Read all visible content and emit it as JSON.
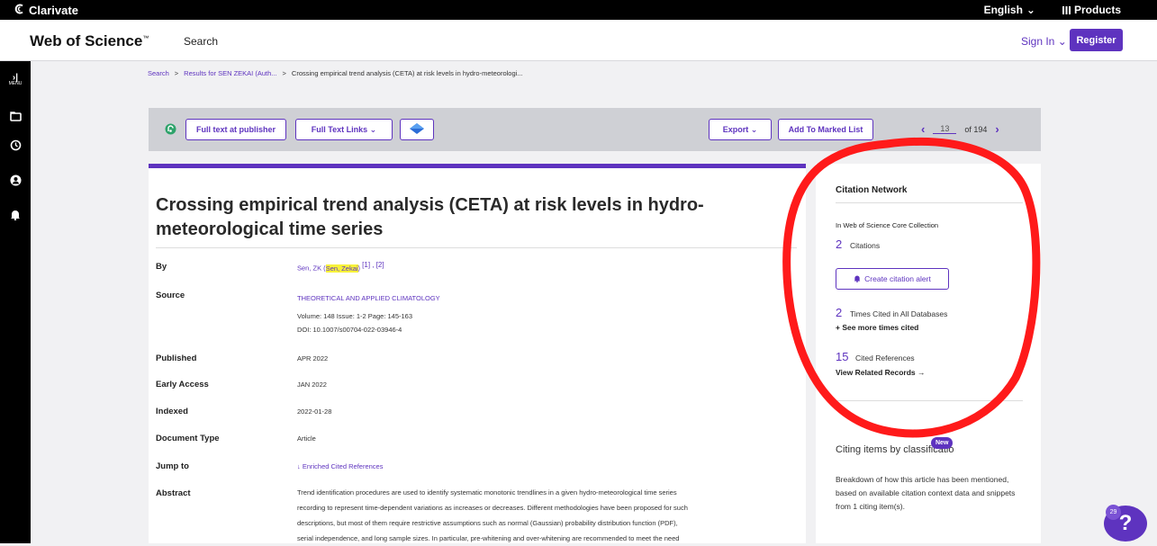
{
  "topbar": {
    "brand": "Clarivate",
    "language": "English",
    "products": "Products"
  },
  "header": {
    "app_title": "Web of Science",
    "trademark": "™",
    "search_link": "Search",
    "sign_in": "Sign In",
    "register": "Register"
  },
  "rail": {
    "menu_label": "MENU",
    "icons": [
      "expand-icon",
      "folder-icon",
      "history-icon",
      "account-icon",
      "bell-icon"
    ]
  },
  "breadcrumb": {
    "items": [
      "Search",
      "Results for SEN ZEKAI (Auth...",
      "Crossing empirical trend analysis (CETA) at risk levels in hydro-meteorologi..."
    ],
    "separator": ">"
  },
  "toolbar": {
    "full_text_publisher": "Full text at publisher",
    "full_text_links": "Full Text Links",
    "export": "Export",
    "add_marked": "Add To Marked List",
    "page_current": "13",
    "page_total": "of 194"
  },
  "record": {
    "title_line1": "Crossing empirical trend analysis (CETA) at risk levels in hydro-",
    "title_line2": "meteorological time series",
    "fields": {
      "by_label": "By",
      "by_value_prefix": "Sen, ZK (",
      "by_value_highlight": "Sen, Zekai",
      "by_value_suffix": ")",
      "by_refs": "[1] , [2]",
      "source_label": "Source",
      "source_journal": "THEORETICAL AND APPLIED CLIMATOLOGY",
      "source_volume": "Volume: 148    Issue: 1-2    Page: 145-163",
      "source_doi": "DOI: 10.1007/s00704-022-03946-4",
      "published_label": "Published",
      "published_value": "APR 2022",
      "early_access_label": "Early Access",
      "early_access_value": "JAN 2022",
      "indexed_label": "Indexed",
      "indexed_value": "2022-01-28",
      "doc_type_label": "Document Type",
      "doc_type_value": "Article",
      "jump_label": "Jump to",
      "jump_value": "↓ Enriched Cited References",
      "abstract_label": "Abstract"
    },
    "abstract_lines": [
      "Trend identification procedures are used to identify systematic monotonic trendlines in a given hydro-meteorological time series",
      "recording to represent time-dependent variations as increases or decreases. Different methodologies have been proposed for such",
      "descriptions, but most of them require restrictive assumptions such as normal (Gaussian) probability distribution function (PDF),",
      "serial independence, and long sample sizes. In particular, pre-whitening and over-whitening are recommended to meet the need"
    ]
  },
  "citation_network": {
    "title": "Citation Network",
    "subtitle": "In Web of Science Core Collection",
    "citations_count": "2",
    "citations_label": "Citations",
    "alert_button": "Create citation alert",
    "times_cited_count": "2",
    "times_cited_label": "Times Cited in All Databases",
    "see_more": "+ See more times cited",
    "cited_refs_count": "15",
    "cited_refs_label": "Cited References",
    "view_related": "View Related Records →"
  },
  "citing_items": {
    "title": "Citing items by classificatio",
    "new_badge": "New",
    "description": "Breakdown of how this article has been mentioned, based on available citation context data and snippets from 1 citing item(s)."
  },
  "help": {
    "count": "29",
    "symbol": "?"
  },
  "colors": {
    "accent": "#5e33bf",
    "annotation": "#ff1a1a",
    "highlight": "#f7f23a"
  }
}
